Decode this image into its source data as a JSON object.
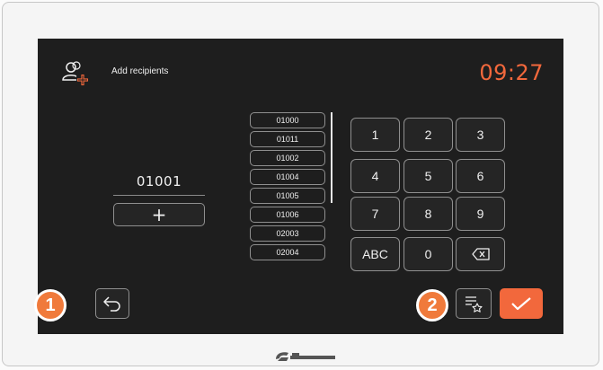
{
  "header": {
    "title": "Add recipients",
    "clock": "09:27",
    "icon": "add-user-icon"
  },
  "entry": {
    "value": "01001",
    "add_button": "+"
  },
  "recipients_list": [
    "01000",
    "01011",
    "01002",
    "01004",
    "01005",
    "01006",
    "02003",
    "02004"
  ],
  "keypad": [
    "1",
    "2",
    "3",
    "4",
    "5",
    "6",
    "7",
    "8",
    "9",
    "ABC",
    "0",
    "backspace-icon"
  ],
  "footer": {
    "back_icon": "back-arrow-icon",
    "phonebook_icon": "favorites-list-icon",
    "confirm_icon": "checkmark-icon"
  },
  "callouts": [
    "1",
    "2"
  ],
  "colors": {
    "accent": "#f2683c",
    "screen_bg": "#1e1e1e",
    "callout": "#f07a3b"
  }
}
